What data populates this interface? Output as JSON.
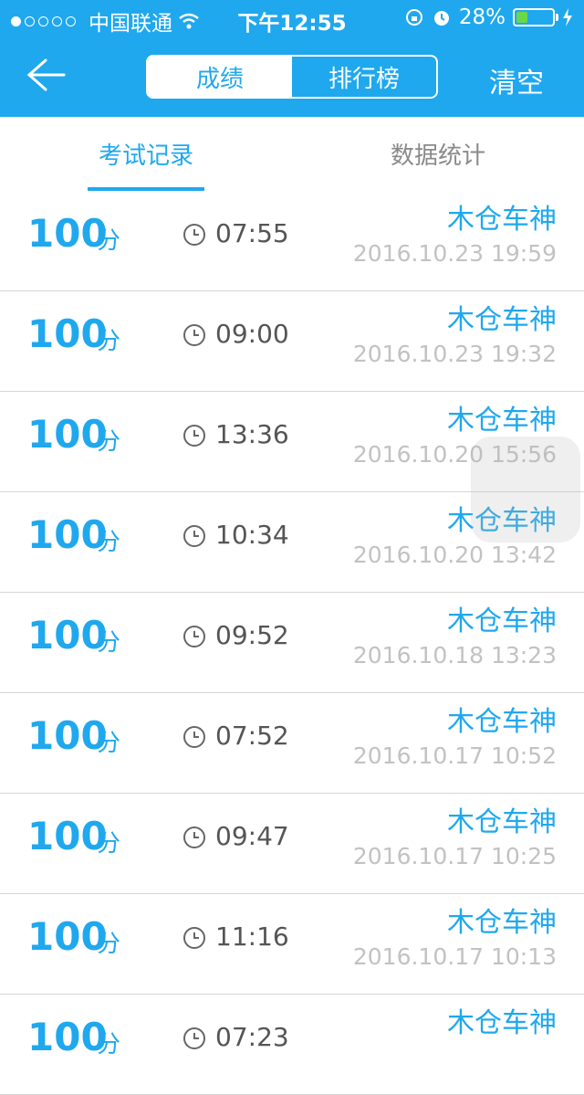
{
  "status_bar": {
    "carrier": "中国联通",
    "time": "下午12:55",
    "battery": "28%",
    "battery_level": 0.28
  },
  "nav": {
    "segments": [
      "成绩",
      "排行榜"
    ],
    "active_segment": 0,
    "clear_label": "清空"
  },
  "tabs": [
    {
      "label": "考试记录",
      "active": true
    },
    {
      "label": "数据统计",
      "active": false
    }
  ],
  "records": [
    {
      "score": "100",
      "unit": "分",
      "duration": "07:55",
      "user": "木仓车神",
      "date": "2016.10.23 19:59"
    },
    {
      "score": "100",
      "unit": "分",
      "duration": "09:00",
      "user": "木仓车神",
      "date": "2016.10.23 19:32"
    },
    {
      "score": "100",
      "unit": "分",
      "duration": "13:36",
      "user": "木仓车神",
      "date": "2016.10.20 15:56"
    },
    {
      "score": "100",
      "unit": "分",
      "duration": "10:34",
      "user": "木仓车神",
      "date": "2016.10.20 13:42"
    },
    {
      "score": "100",
      "unit": "分",
      "duration": "09:52",
      "user": "木仓车神",
      "date": "2016.10.18 13:23"
    },
    {
      "score": "100",
      "unit": "分",
      "duration": "07:52",
      "user": "木仓车神",
      "date": "2016.10.17 10:52"
    },
    {
      "score": "100",
      "unit": "分",
      "duration": "09:47",
      "user": "木仓车神",
      "date": "2016.10.17 10:25"
    },
    {
      "score": "100",
      "unit": "分",
      "duration": "11:16",
      "user": "木仓车神",
      "date": "2016.10.17 10:13"
    },
    {
      "score": "100",
      "unit": "分",
      "duration": "07:23",
      "user": "木仓车神",
      "date": ""
    }
  ],
  "colors": {
    "accent": "#1fa8ee",
    "date_gray": "#c2c2c2"
  }
}
